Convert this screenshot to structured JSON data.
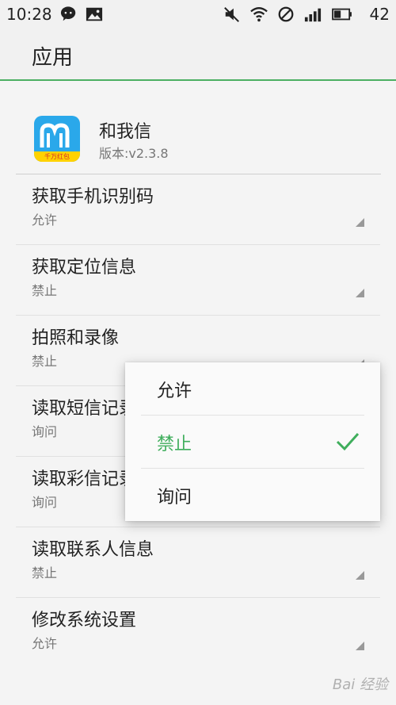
{
  "status_bar": {
    "time": "10:28",
    "battery_level": "42",
    "icons": [
      "wechat-icon",
      "image-icon",
      "mute-icon",
      "wifi-icon",
      "dnd-icon",
      "signal-icon",
      "battery-icon"
    ]
  },
  "header": {
    "title": "应用"
  },
  "app": {
    "name": "和我信",
    "version": "版本:v2.3.8",
    "icon_badge": "千万红包"
  },
  "permissions": [
    {
      "title": "获取手机识别码",
      "value": "允许"
    },
    {
      "title": "获取定位信息",
      "value": "禁止"
    },
    {
      "title": "拍照和录像",
      "value": "禁止"
    },
    {
      "title": "读取短信记录",
      "value": "询问"
    },
    {
      "title": "读取彩信记录",
      "value": "询问"
    },
    {
      "title": "读取联系人信息",
      "value": "禁止"
    },
    {
      "title": "修改系统设置",
      "value": "允许"
    }
  ],
  "popup": {
    "options": [
      {
        "label": "允许",
        "selected": false
      },
      {
        "label": "禁止",
        "selected": true
      },
      {
        "label": "询问",
        "selected": false
      }
    ]
  },
  "colors": {
    "accent": "#3fae5c",
    "header_line": "#4caf62",
    "app_icon": "#2aa8ea"
  },
  "watermark": "Bai 经验"
}
